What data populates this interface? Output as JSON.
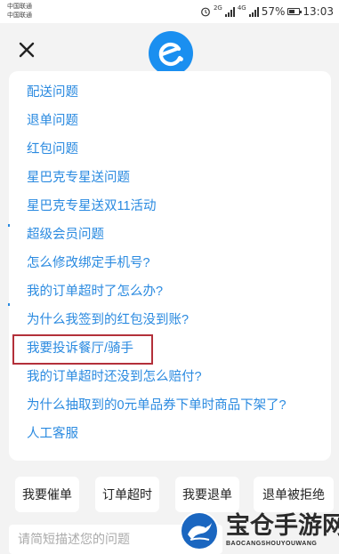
{
  "status_bar": {
    "carrier_1": "中国联通",
    "carrier_2": "中国联通",
    "network_1": "2G",
    "network_2": "4G",
    "battery": "57%",
    "time": "13:03"
  },
  "header": {
    "close_icon": "close-icon",
    "logo_icon": "eleme-logo-icon",
    "brand_color": "#1a8ff0"
  },
  "faq": {
    "items": [
      "配送问题",
      "退单问题",
      "红包问题",
      "星巴克专星送问题",
      "星巴克专星送双11活动",
      "超级会员问题",
      "怎么修改绑定手机号?",
      "我的订单超时了怎么办?",
      "为什么我签到的红包没到账?",
      "我要投诉餐厅/骑手",
      "我的订单超时还没到怎么赔付?",
      "为什么抽取到的0元单品券下单时商品下架了?",
      "人工客服"
    ],
    "link_color": "#2a8ae0",
    "highlight_color": "#b3303a"
  },
  "quick_actions": [
    "我要催单",
    "订单超时",
    "我要退单",
    "退单被拒绝"
  ],
  "input": {
    "placeholder": "请简短描述您的问题"
  },
  "watermark": {
    "title": "宝仓手游网",
    "subtitle": "BAOCANGSHOUYOUWANG"
  }
}
